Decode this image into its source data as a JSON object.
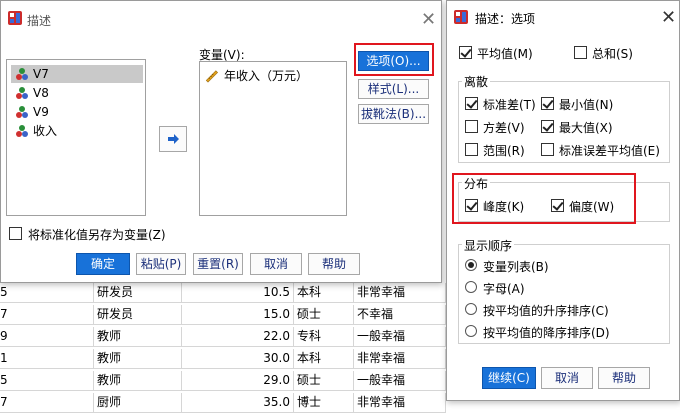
{
  "background_table": {
    "rows": [
      {
        "id": "5",
        "dept": "研发员",
        "income": "10.5",
        "edu": "本科",
        "happy": "非常幸福"
      },
      {
        "id": "7",
        "dept": "研发员",
        "income": "15.0",
        "edu": "硕士",
        "happy": "不幸福"
      },
      {
        "id": "9",
        "dept": "教师",
        "income": "22.0",
        "edu": "专科",
        "happy": "一般幸福"
      },
      {
        "id": "1",
        "dept": "教师",
        "income": "30.0",
        "edu": "本科",
        "happy": "非常幸福"
      },
      {
        "id": "5",
        "dept": "教师",
        "income": "29.0",
        "edu": "硕士",
        "happy": "一般幸福"
      },
      {
        "id": "7",
        "dept": "厨师",
        "income": "35.0",
        "edu": "博士",
        "happy": "非常幸福"
      }
    ]
  },
  "describe_dialog": {
    "title": "描述",
    "source_vars": [
      "V7",
      "V8",
      "V9",
      "收入"
    ],
    "variables_label": "变量(V):",
    "target_vars": [
      "年收入（万元）"
    ],
    "right_buttons": [
      "选项(O)...",
      "样式(L)...",
      "拔靴法(B)..."
    ],
    "save_standardized": "将标准化值另存为变量(Z)",
    "bottom_buttons": [
      "确定",
      "粘贴(P)",
      "重置(R)",
      "取消",
      "帮助"
    ]
  },
  "options_dialog": {
    "title": "描述：选项",
    "mean": {
      "label": "平均值(M)",
      "checked": true
    },
    "sum": {
      "label": "总和(S)",
      "checked": false
    },
    "dispersion_title": "离散",
    "dispersion": [
      {
        "label": "标准差(T)",
        "checked": true
      },
      {
        "label": "最小值(N)",
        "checked": true
      },
      {
        "label": "方差(V)",
        "checked": false
      },
      {
        "label": "最大值(X)",
        "checked": true
      },
      {
        "label": "范围(R)",
        "checked": false
      },
      {
        "label": "标准误差平均值(E)",
        "checked": false
      }
    ],
    "distribution_title": "分布",
    "distribution": [
      {
        "label": "峰度(K)",
        "checked": true
      },
      {
        "label": "偏度(W)",
        "checked": true
      }
    ],
    "order_title": "显示顺序",
    "order_options": [
      {
        "label": "变量列表(B)",
        "selected": true
      },
      {
        "label": "字母(A)",
        "selected": false
      },
      {
        "label": "按平均值的升序排序(C)",
        "selected": false
      },
      {
        "label": "按平均值的降序排序(D)",
        "selected": false
      }
    ],
    "buttons": [
      "继续(C)",
      "取消",
      "帮助"
    ]
  },
  "colors": {
    "accent": "#1872d9",
    "highlight": "#e0161e"
  }
}
